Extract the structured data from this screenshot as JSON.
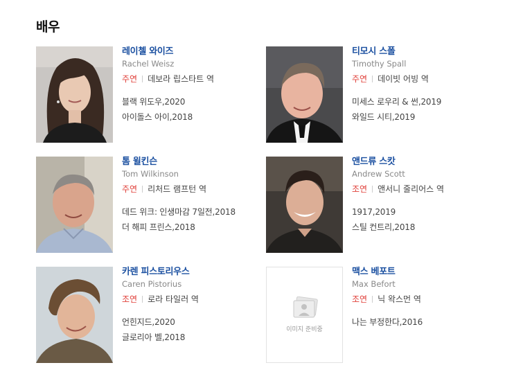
{
  "section": {
    "title": "배우"
  },
  "actors": [
    {
      "name": "레이첼 와이즈",
      "english_name": "Rachel Weisz",
      "role": "주연",
      "character": "데보라 립스타트 역",
      "works": [
        "블랙 위도우,2020",
        "아이돌스 아이,2018"
      ]
    },
    {
      "name": "티모시 스폴",
      "english_name": "Timothy Spall",
      "role": "주연",
      "character": "데이빗 어빙 역",
      "works": [
        "미세스 로우리 & 썬,2019",
        "와일드 시티,2019"
      ]
    },
    {
      "name": "톰 윌킨슨",
      "english_name": "Tom Wilkinson",
      "role": "주연",
      "character": "리처드 램프턴 역",
      "works": [
        "데드 위크: 인생마감 7일전,2018",
        "더 해피 프린스,2018"
      ]
    },
    {
      "name": "앤드류 스캇",
      "english_name": "Andrew Scott",
      "role": "조연",
      "character": "앤서니 줄리어스 역",
      "works": [
        "1917,2019",
        "스틸 컨트리,2018"
      ]
    },
    {
      "name": "카렌 피스토리우스",
      "english_name": "Caren Pistorius",
      "role": "조연",
      "character": "로라 타일러 역",
      "works": [
        "언힌지드,2020",
        "글로리아 벨,2018"
      ]
    },
    {
      "name": "맥스 베포트",
      "english_name": "Max Befort",
      "role": "조연",
      "character": "닉 왁스먼 역",
      "works": [
        "나는 부정한다,2016"
      ],
      "image_placeholder": "이미지 준비중"
    }
  ]
}
